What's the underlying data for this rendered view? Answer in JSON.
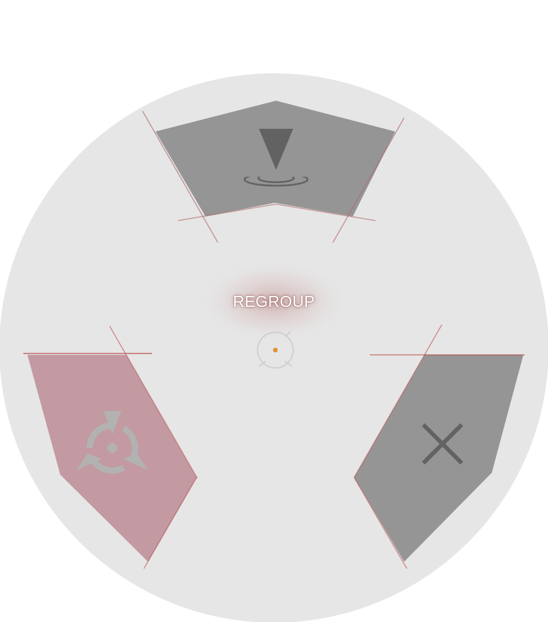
{
  "wheel": {
    "selected_label": "REGROUP",
    "background_color": "#e6e6e6",
    "segments": [
      {
        "id": "move",
        "icon": "move-to-location-icon",
        "state": "default",
        "color": "#959596"
      },
      {
        "id": "regroup",
        "icon": "regroup-icon",
        "state": "highlighted",
        "color": "#c39aa1"
      },
      {
        "id": "cancel",
        "icon": "close-icon",
        "state": "default",
        "color": "#959596"
      }
    ],
    "accent_color": "#b43c3c",
    "cursor_dot_color": "#e0903a"
  }
}
